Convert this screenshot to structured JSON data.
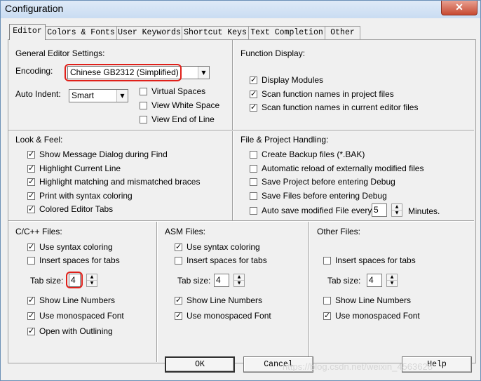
{
  "window": {
    "title": "Configuration",
    "close_glyph": "✕"
  },
  "tabs": [
    "Editor",
    "Colors & Fonts",
    "User Keywords",
    "Shortcut Keys",
    "Text Completion",
    "Other"
  ],
  "general": {
    "heading": "General Editor Settings:",
    "encoding_label": "Encoding:",
    "encoding_value": "Chinese GB2312 (Simplified)",
    "auto_indent_label": "Auto Indent:",
    "auto_indent_value": "Smart",
    "virtual_spaces": "Virtual Spaces",
    "view_white_space": "View White Space",
    "view_end_of_line": "View End of Line",
    "virtual_spaces_checked": false,
    "view_white_space_checked": false,
    "view_end_of_line_checked": false
  },
  "function_display": {
    "heading": "Function Display:",
    "items": [
      {
        "label": "Display Modules",
        "checked": true
      },
      {
        "label": "Scan function names in project files",
        "checked": true
      },
      {
        "label": "Scan function names in current editor files",
        "checked": true
      }
    ]
  },
  "look_feel": {
    "heading": "Look & Feel:",
    "items": [
      {
        "label": "Show Message Dialog during Find",
        "checked": true
      },
      {
        "label": "Highlight Current Line",
        "checked": true
      },
      {
        "label": "Highlight matching and mismatched braces",
        "checked": true
      },
      {
        "label": "Print with syntax coloring",
        "checked": true
      },
      {
        "label": "Colored Editor Tabs",
        "checked": true
      }
    ]
  },
  "file_project": {
    "heading": "File & Project Handling:",
    "items": [
      {
        "label": "Create Backup files (*.BAK)",
        "checked": false
      },
      {
        "label": "Automatic reload of externally modified files",
        "checked": false
      },
      {
        "label": "Save Project before entering Debug",
        "checked": false
      },
      {
        "label": "Save Files before entering Debug",
        "checked": false
      },
      {
        "label": "Auto save modified File every",
        "checked": false
      }
    ],
    "autosave_value": "5",
    "minutes_label": "Minutes."
  },
  "cpp_files": {
    "heading": "C/C++ Files:",
    "use_syntax": "Use syntax coloring",
    "use_syntax_checked": true,
    "insert_spaces": "Insert spaces for tabs",
    "insert_spaces_checked": false,
    "tab_size_label": "Tab size:",
    "tab_size_value": "4",
    "show_line_numbers": "Show Line Numbers",
    "show_line_numbers_checked": true,
    "monospaced": "Use monospaced Font",
    "monospaced_checked": true,
    "outlining": "Open with Outlining",
    "outlining_checked": true
  },
  "asm_files": {
    "heading": "ASM Files:",
    "use_syntax": "Use syntax coloring",
    "use_syntax_checked": true,
    "insert_spaces": "Insert spaces for tabs",
    "insert_spaces_checked": false,
    "tab_size_label": "Tab size:",
    "tab_size_value": "4",
    "show_line_numbers": "Show Line Numbers",
    "show_line_numbers_checked": true,
    "monospaced": "Use monospaced Font",
    "monospaced_checked": true
  },
  "other_files": {
    "heading": "Other Files:",
    "insert_spaces": "Insert spaces for tabs",
    "insert_spaces_checked": false,
    "tab_size_label": "Tab size:",
    "tab_size_value": "4",
    "show_line_numbers": "Show Line Numbers",
    "show_line_numbers_checked": false,
    "monospaced": "Use monospaced Font",
    "monospaced_checked": true
  },
  "buttons": {
    "ok": "OK",
    "cancel": "Cancel",
    "help": "Help"
  },
  "watermark": "https://blog.csdn.net/weixin_4563628",
  "colors": {
    "highlight_ring": "#e0201a",
    "title_bar": "#c9dcf2",
    "close_button": "#c74a32"
  }
}
